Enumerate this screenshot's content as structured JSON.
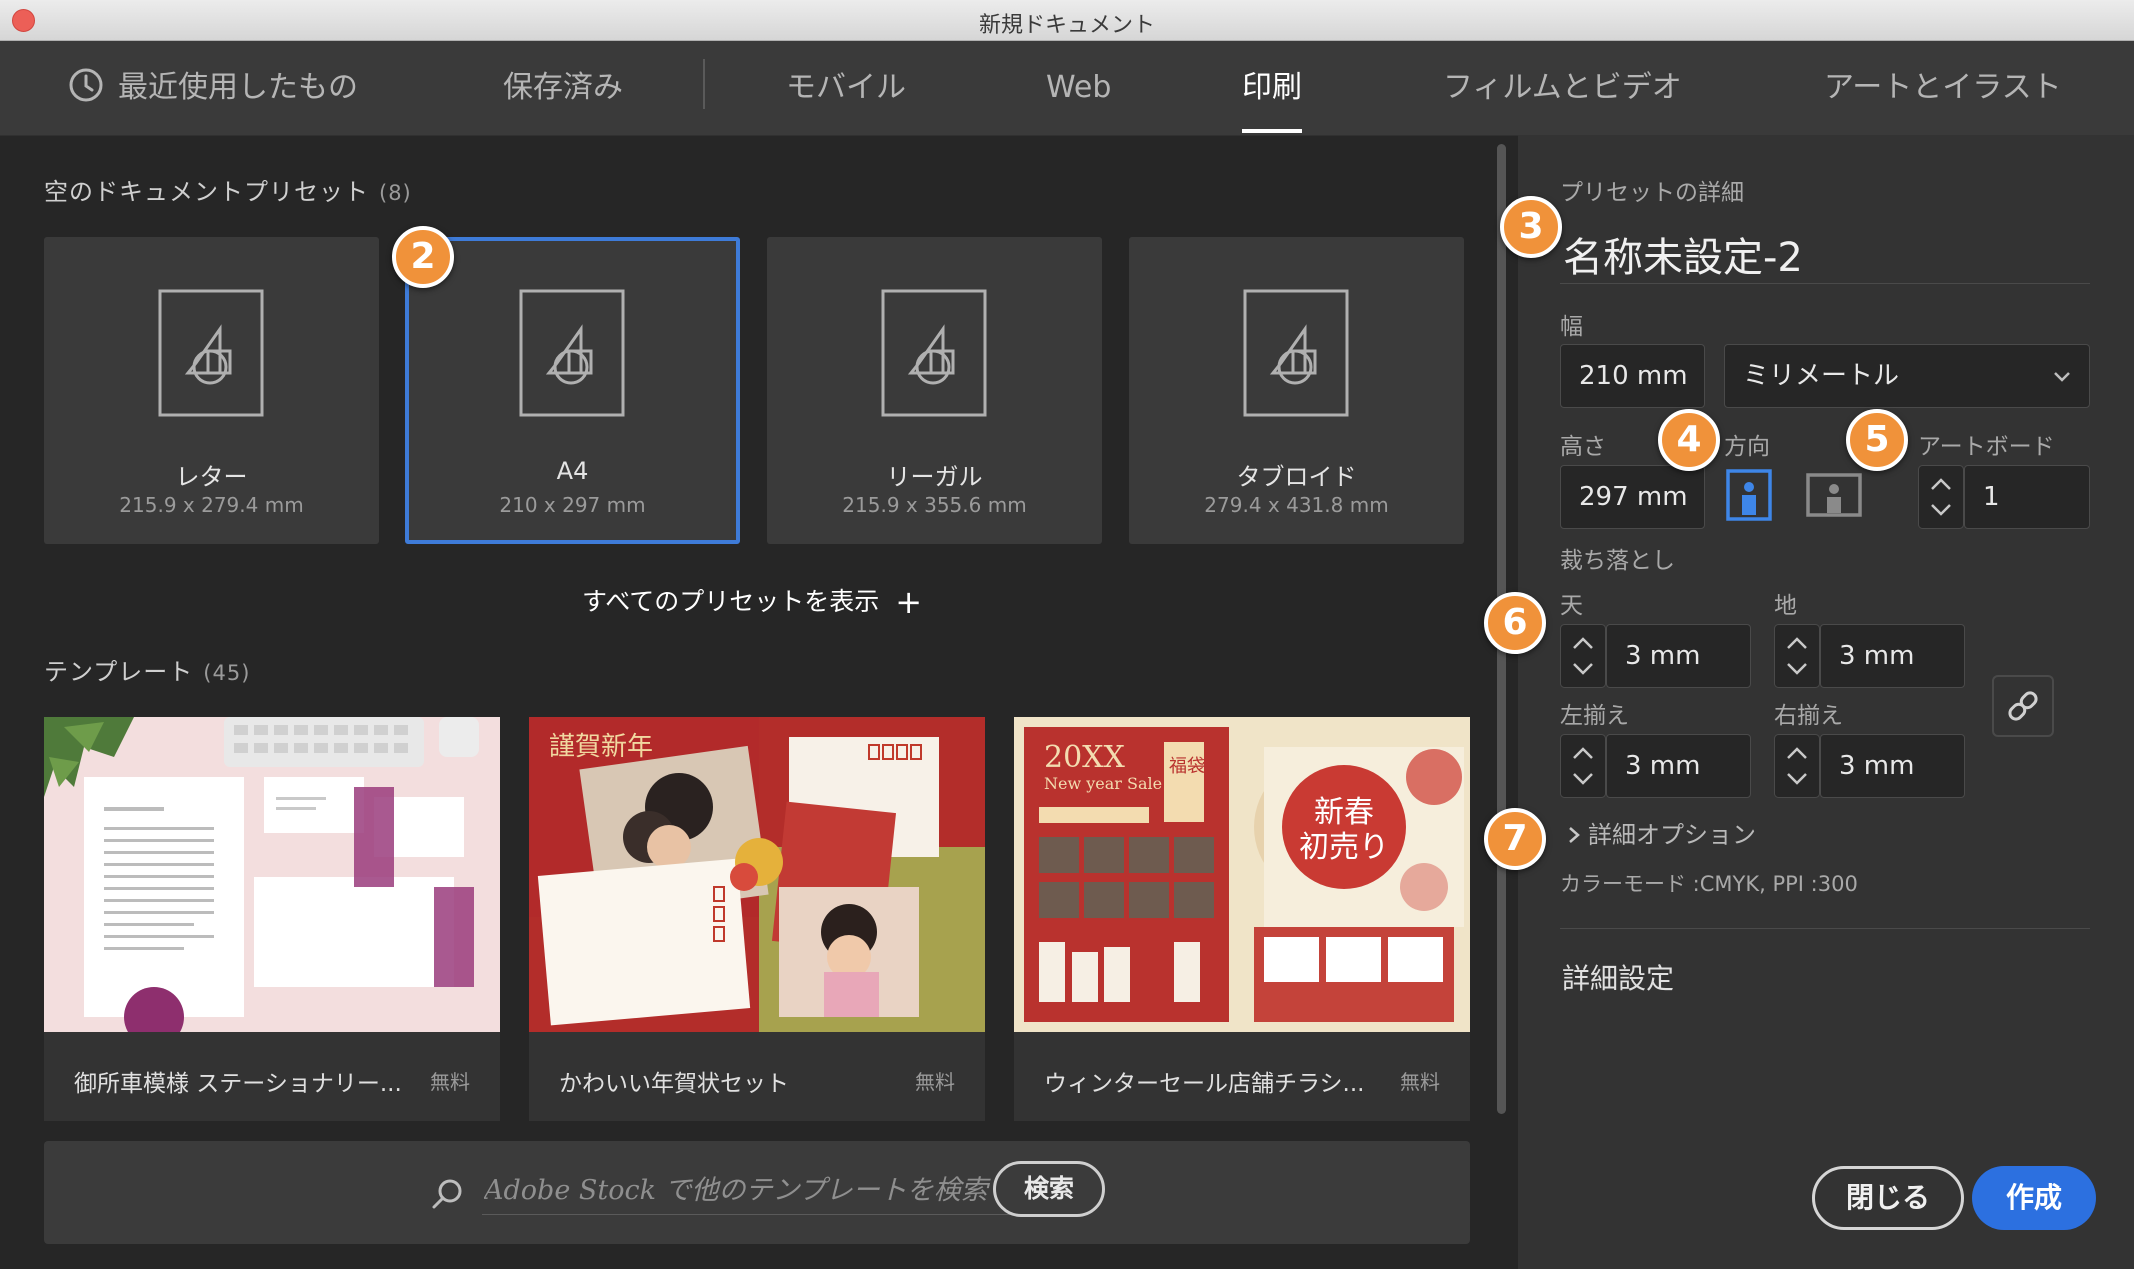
{
  "window": {
    "title": "新規ドキュメント"
  },
  "tabs": [
    {
      "label": "最近使用したもの",
      "icon": "clock-icon"
    },
    {
      "label": "保存済み"
    },
    {
      "label": "モバイル"
    },
    {
      "label": "Web"
    },
    {
      "label": "印刷",
      "active": true
    },
    {
      "label": "フィルムとビデオ"
    },
    {
      "label": "アートとイラスト"
    }
  ],
  "presets": {
    "title": "空のドキュメントプリセット",
    "count": "(8)",
    "items": [
      {
        "name": "レター",
        "size": "215.9 x 279.4 mm"
      },
      {
        "name": "A4",
        "size": "210 x 297 mm",
        "selected": true
      },
      {
        "name": "リーガル",
        "size": "215.9 x 355.6 mm"
      },
      {
        "name": "タブロイド",
        "size": "279.4 x 431.8 mm"
      }
    ],
    "show_all": "すべてのプリセットを表示",
    "show_all_icon": "plus-icon"
  },
  "templates": {
    "title": "テンプレート",
    "count": "(45)",
    "items": [
      {
        "name": "御所車模様 ステーショナリー...",
        "price": "無料"
      },
      {
        "name": "かわいい年賀状セット",
        "price": "無料"
      },
      {
        "name": "ウィンターセール店舗チラシ...",
        "price": "無料"
      }
    ],
    "card_art_text": {
      "newyear_greeting": "謹賀新年",
      "sale_year": "20XX",
      "sale_subtitle": "New year Sale",
      "sale_badge": "福袋",
      "sale_headline_1": "新春",
      "sale_headline_2": "初売り"
    }
  },
  "search": {
    "placeholder": "Adobe Stock で他のテンプレートを検索",
    "value": "",
    "button": "検索"
  },
  "details": {
    "section_label": "プリセットの詳細",
    "doc_name": "名称未設定-2",
    "width_label": "幅",
    "width_value": "210 mm",
    "unit": "ミリメートル",
    "height_label": "高さ",
    "height_value": "297 mm",
    "orientation_label": "方向",
    "artboard_label": "アートボード",
    "artboard_value": "1",
    "bleed_label": "裁ち落とし",
    "bleed_top_label": "天",
    "bleed_top": "3 mm",
    "bleed_bottom_label": "地",
    "bleed_bottom": "3 mm",
    "bleed_left_label": "左揃え",
    "bleed_left": "3 mm",
    "bleed_right_label": "右揃え",
    "bleed_right": "3 mm",
    "more_options": "詳細オプション",
    "color_mode": "カラーモード :CMYK, PPI :300",
    "advanced": "詳細設定",
    "close": "閉じる",
    "create": "作成"
  },
  "markers": [
    "2",
    "3",
    "4",
    "5",
    "6",
    "7"
  ],
  "colors": {
    "accent_blue": "#2c70e0",
    "selection_border": "#3e7bd8",
    "marker_orange": "#f0923a",
    "portrait_active": "#3e86e8"
  }
}
